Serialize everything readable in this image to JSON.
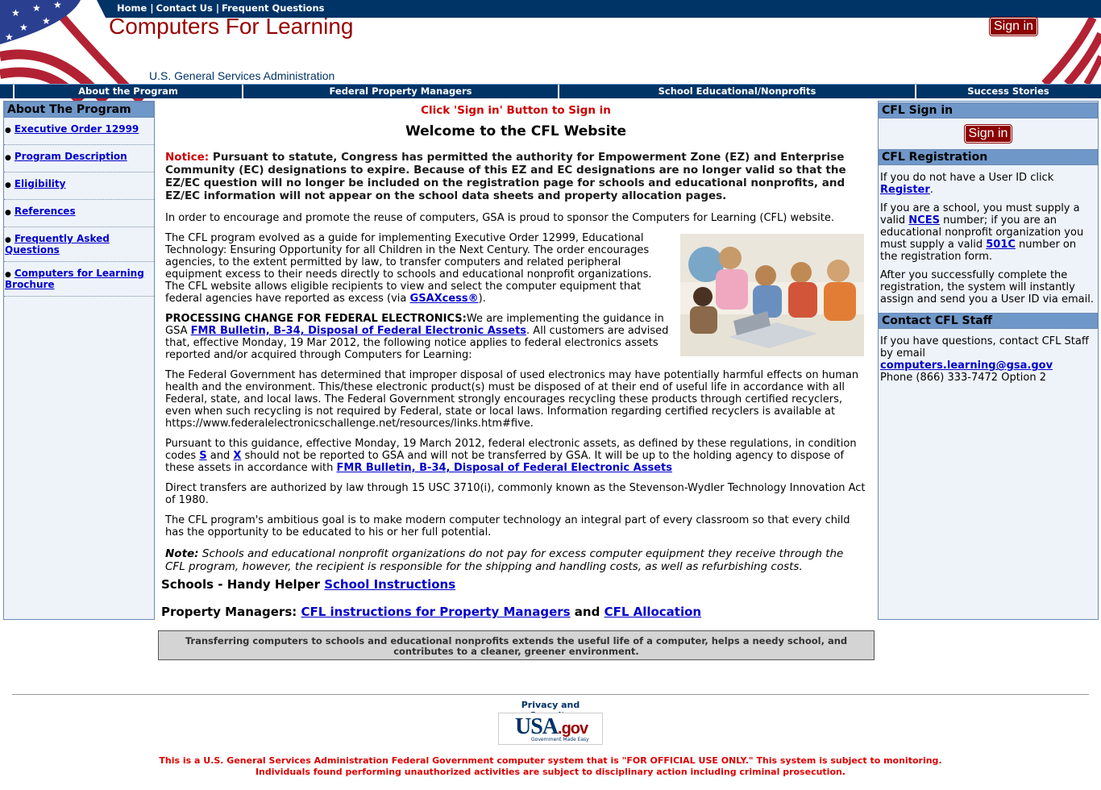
{
  "top_links": [
    "Home",
    "Contact Us",
    "Frequent Questions"
  ],
  "header": {
    "site_title": "Computers For Learning",
    "agency": "U.S. General Services Administration",
    "sign_in": "Sign in"
  },
  "nav": [
    "About the Program",
    "Federal Property Managers",
    "School Educational/Nonprofits",
    "Success Stories"
  ],
  "left": {
    "heading": "About The Program",
    "items": [
      "Executive Order 12999",
      "Program Description",
      "Eligibility",
      "References",
      "Frequently Asked Questions",
      "Computers for Learning Brochure"
    ]
  },
  "main": {
    "signin_msg": "Click 'Sign in' Button to Sign in",
    "welcome": "Welcome to the CFL Website",
    "notice_label": "Notice:",
    "notice_text": "Pursuant to statute, Congress has permitted the authority for Empowerment Zone (EZ) and Enterprise Community (EC) designations to expire. Because of this EZ and EC designations are no longer valid so that the EZ/EC question will no longer be included on the registration page for schools and educational nonprofits, and EZ/EC information will not appear on the school data sheets and property allocation pages.",
    "p_intro": "In order to encourage and promote the reuse of computers, GSA is proud to sponsor the Computers for Learning (CFL) website.",
    "p_evolved": "The CFL program evolved as a guide for implementing Executive Order 12999, Educational Technology: Ensuring Opportunity for all Children in the Next Century. The order encourages agencies, to the extent permitted by law, to transfer computers and related peripheral equipment excess to their needs directly to schools and educational nonprofit organizations. The CFL website allows eligible recipients to view and select the computer equipment that federal agencies have reported as excess (via ",
    "gsaxcess_link": "GSAXcess®",
    "p_evolved_end": ").",
    "processing_label": "PROCESSING CHANGE FOR FEDERAL ELECTRONICS:",
    "processing_text": "We are implementing the guidance in GSA ",
    "fmr_link": "FMR Bulletin, B-34, Disposal of Federal Electronic Assets",
    "processing_text2": ". All customers are advised that, effective Monday, 19 Mar 2012, the following notice applies to federal electronics assets reported and/or acquired through Computers for Learning:",
    "p_disposal": "The Federal Government has determined that improper disposal of used electronics may have potentially harmful effects on human health and the environment. This/these electronic product(s) must be disposed of at their end of useful life in accordance with all Federal, state, and local laws. The Federal Government strongly encourages recycling these products through certified recyclers, even when such recycling is not required by Federal, state or local laws. Information regarding certified recyclers is available at https://www.federalelectronicschallenge.net/resources/links.htm#five.",
    "p_guidance_a": "Pursuant to this guidance, effective Monday, 19 March 2012, federal electronic assets, as defined by these regulations, in condition codes ",
    "code_s": "S",
    "p_guidance_b": " and ",
    "code_x": "X",
    "p_guidance_c": " should not be reported to GSA and will not be transferred by GSA. It will be up to the holding agency to dispose of these assets in accordance with ",
    "fmr_link2": "FMR Bulletin, B-34, Disposal of Federal Electronic Assets",
    "p_direct": "Direct transfers are authorized by law through 15 USC 3710(i), commonly known as the Stevenson-Wydler Technology Innovation Act of 1980.",
    "p_goal": "The CFL program's ambitious goal is to make modern computer technology an integral part of every classroom so that every child has the opportunity to be educated to his or her full potential.",
    "note_label": "Note:",
    "note_text": " Schools and educational nonprofit organizations do not pay for excess computer equipment they receive through the CFL program, however, the recipient is responsible for the shipping and handling costs, as well as refurbishing costs.",
    "schools_label": "Schools - Handy Helper ",
    "schools_link": "School Instructions",
    "pm_label": "Property Managers: ",
    "pm_link1": "CFL instructions for Property Managers",
    "pm_and": " and ",
    "pm_link2": "CFL Allocation",
    "transfer_text": "Transferring computers to schools and educational nonprofits extends the useful life of a computer, helps a needy school, and contributes to a cleaner, greener environment."
  },
  "right": {
    "signin_heading": "CFL Sign in",
    "sign_in": "Sign in",
    "reg_heading": "CFL Registration",
    "reg_p1": "If you do not have a User ID click ",
    "reg_link": "Register",
    "reg_p1_end": ".",
    "reg_p2a": "If you are a school, you must supply a valid ",
    "nces_link": "NCES",
    "reg_p2b": " number; if you are an educational nonprofit organization you must supply a valid ",
    "c501_link": "501C",
    "reg_p2c": " number on the registration form.",
    "reg_p3": "After you successfully complete the registration, the system will instantly assign and send you a User ID via email.",
    "contact_heading": "Contact CFL Staff",
    "contact_p": "If you have questions, contact CFL Staff by email ",
    "contact_email": "computers.learning@gsa.gov",
    "contact_phone": "Phone (866) 333-7472 Option 2"
  },
  "footer": {
    "privacy": "Privacy and Security",
    "usagov_main": "USA",
    "usagov_gov": ".gov",
    "usagov_sub": "Government Made Easy",
    "warning_line1": "This is a U.S. General Services Administration Federal Government computer system that is \"FOR OFFICIAL USE ONLY.\" This system is subject to monitoring.",
    "warning_line2": "Individuals found performing unauthorized activities are subject to disciplinary action including criminal prosecution."
  }
}
